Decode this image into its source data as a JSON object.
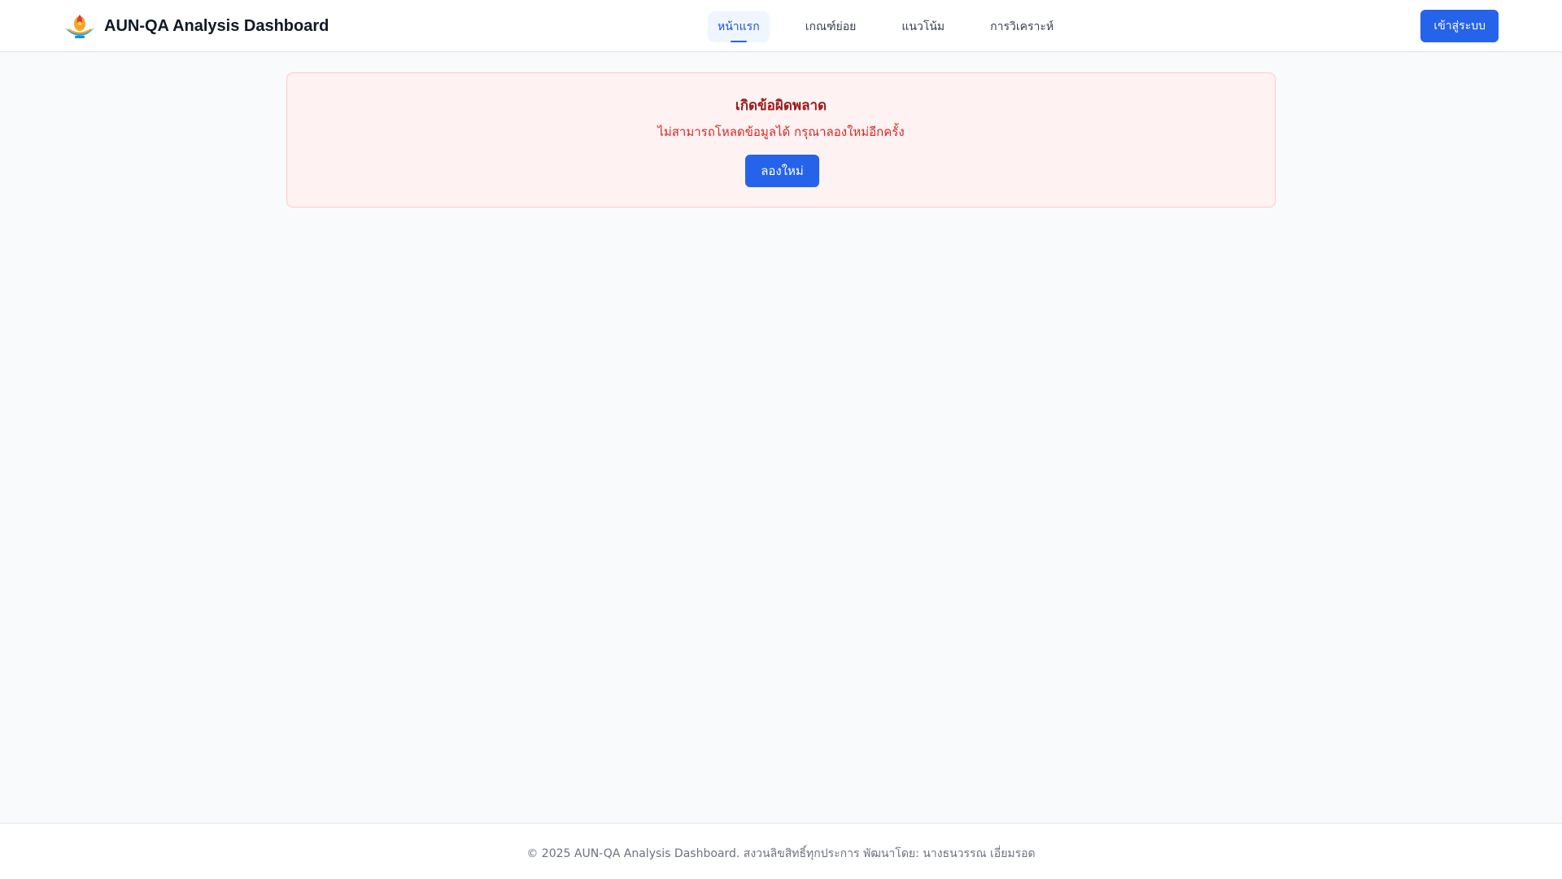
{
  "app": {
    "title": "AUN-QA Analysis Dashboard",
    "logo_icon": "university-emblem-icon"
  },
  "nav": {
    "items": [
      {
        "label": "หน้าแรก",
        "active": true
      },
      {
        "label": "เกณฑ์ย่อย",
        "active": false
      },
      {
        "label": "แนวโน้ม",
        "active": false
      },
      {
        "label": "การวิเคราะห์",
        "active": false
      }
    ]
  },
  "header": {
    "login_label": "เข้าสู่ระบบ"
  },
  "error": {
    "title": "เกิดข้อผิดพลาด",
    "message": "ไม่สามารถโหลดข้อมูลได้ กรุณาลองใหม่อีกครั้ง",
    "retry_label": "ลองใหม่"
  },
  "footer": {
    "text": "© 2025 AUN-QA Analysis Dashboard. สงวนลิขสิทธิ์ทุกประการ พัฒนาโดย: นางธนวรรณ เอี่ยมรอด"
  },
  "colors": {
    "accent": "#2563eb",
    "error_bg": "#fef2f2",
    "error_title": "#991b1b",
    "error_text": "#dc2626"
  }
}
